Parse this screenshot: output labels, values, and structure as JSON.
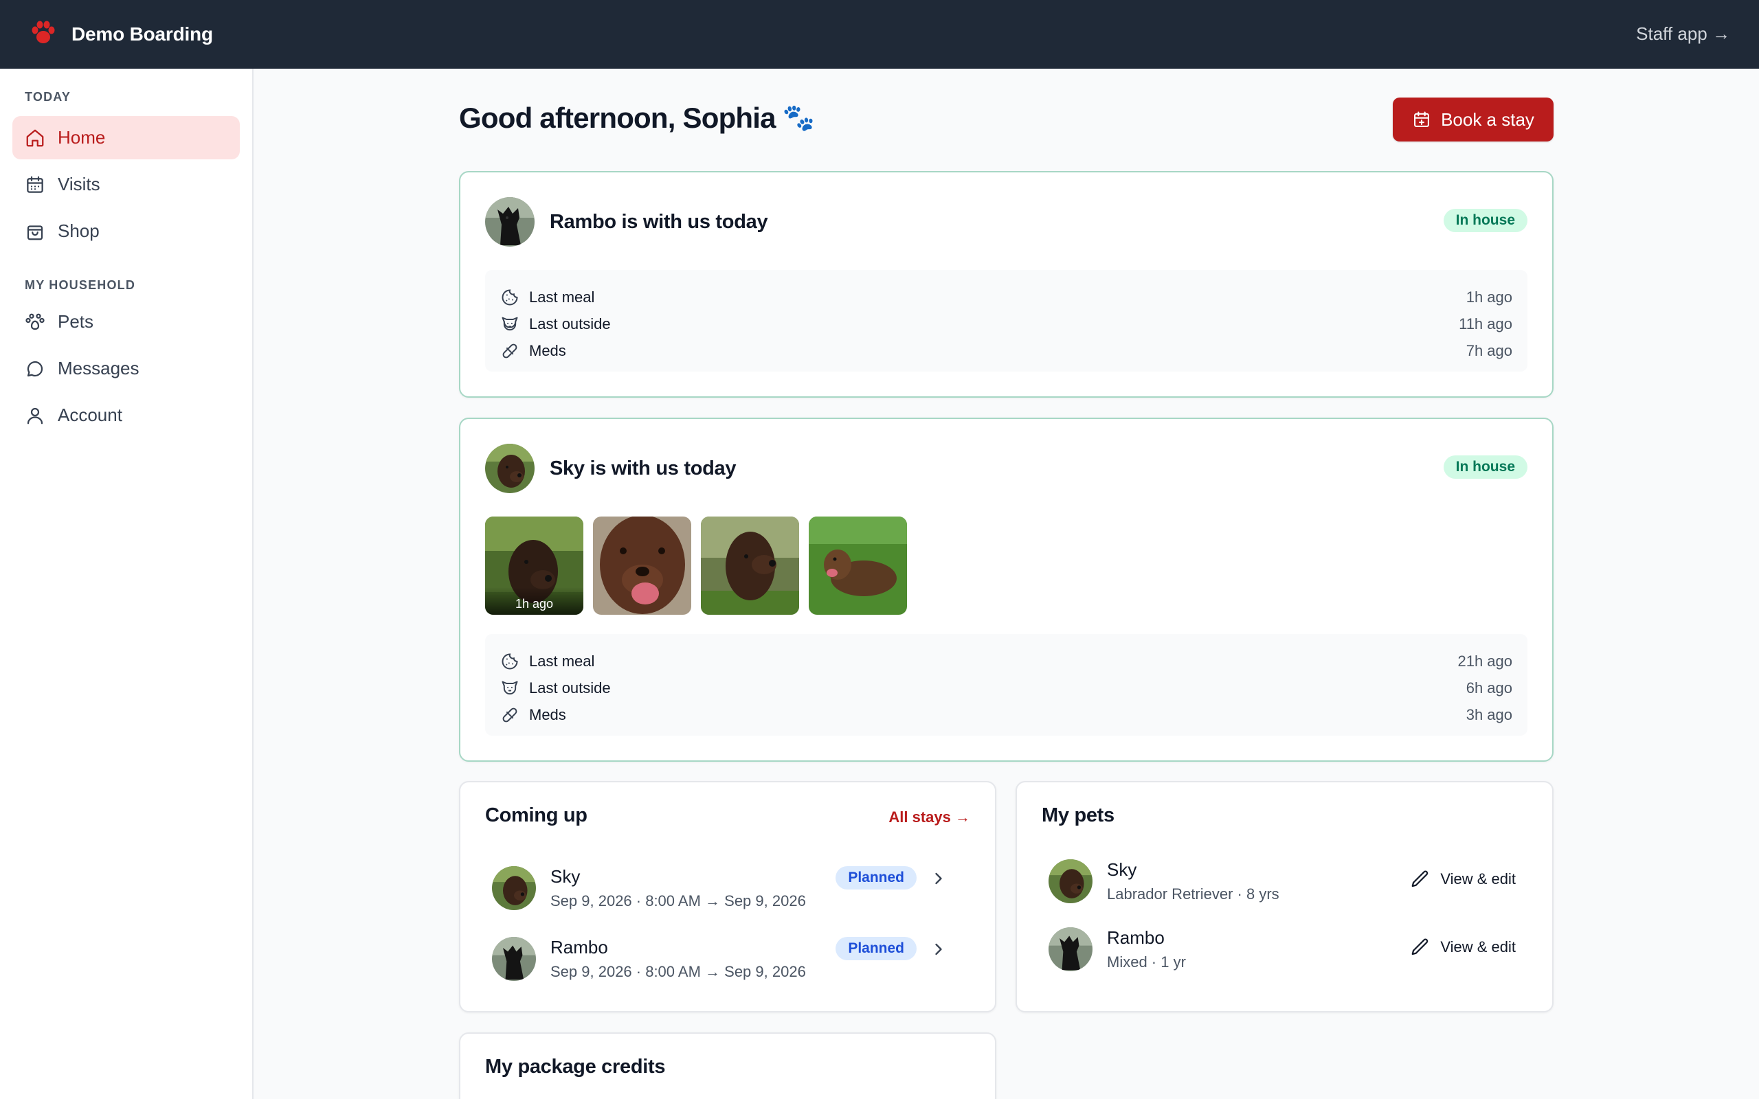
{
  "topbar": {
    "brand": "Demo Boarding",
    "staff_link": "Staff app →"
  },
  "sidebar": {
    "section_today": "TODAY",
    "section_household": "MY HOUSEHOLD",
    "items": [
      {
        "label": "Home",
        "icon": "home-icon",
        "active": true
      },
      {
        "label": "Visits",
        "icon": "calendar-icon"
      },
      {
        "label": "Shop",
        "icon": "shopping-bag-icon"
      },
      {
        "label": "Pets",
        "icon": "paw-icon"
      },
      {
        "label": "Messages",
        "icon": "chat-icon"
      },
      {
        "label": "Account",
        "icon": "user-icon"
      }
    ]
  },
  "main": {
    "greeting": "Good afternoon, Sophia",
    "greeting_emoji": "🐾",
    "book_button": "Book a stay",
    "stays_today": [
      {
        "title": "Rambo is with us today",
        "badge": "In house",
        "stats": [
          {
            "label": "Last meal",
            "value": "1h ago",
            "icon": "cookie-icon"
          },
          {
            "label": "Last outside",
            "value": "11h ago",
            "icon": "dog-icon"
          },
          {
            "label": "Meds",
            "value": "7h ago",
            "icon": "pill-icon"
          }
        ]
      },
      {
        "title": "Sky is with us today",
        "badge": "In house",
        "photo_caption": "1h ago",
        "stats": [
          {
            "label": "Last meal",
            "value": "21h ago",
            "icon": "cookie-icon"
          },
          {
            "label": "Last outside",
            "value": "6h ago",
            "icon": "dog-icon"
          },
          {
            "label": "Meds",
            "value": "3h ago",
            "icon": "pill-icon"
          }
        ]
      }
    ],
    "coming_up": {
      "title": "Coming up",
      "link": "All stays →",
      "items": [
        {
          "name": "Sky",
          "dates": "Sep 9, 2026 · 8:00 AM → Sep 9, 2026",
          "status": "Planned"
        },
        {
          "name": "Rambo",
          "dates": "Sep 9, 2026 · 8:00 AM → Sep 9, 2026",
          "status": "Planned"
        }
      ]
    },
    "my_pets": {
      "title": "My pets",
      "items": [
        {
          "name": "Sky",
          "details": "Labrador Retriever · 8 yrs",
          "action": "View & edit"
        },
        {
          "name": "Rambo",
          "details": "Mixed · 1 yr",
          "action": "View & edit"
        }
      ]
    },
    "credits": {
      "title": "My package credits"
    }
  },
  "colors": {
    "topbar": "#1f2937",
    "accent": "#b91c1c",
    "in_house_bg": "#d1fae5",
    "planned_bg": "#dbeafe"
  }
}
